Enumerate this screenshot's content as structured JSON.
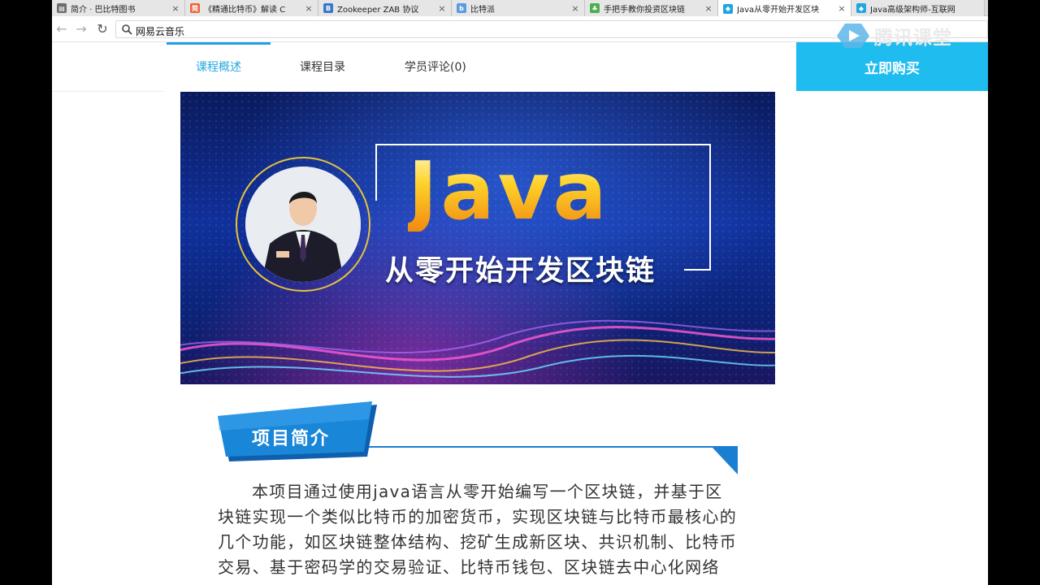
{
  "browser": {
    "tabs": [
      {
        "label": "简介 · 巴比特图书",
        "icon": "book-icon",
        "color": "#5a5a5a"
      },
      {
        "label": "《精通比特币》解读 C",
        "icon": "jian-icon",
        "color": "#e8663d"
      },
      {
        "label": "Zookeeper ZAB 协议",
        "icon": "b-icon",
        "color": "#3a78c9"
      },
      {
        "label": "比特派",
        "icon": "b-icon",
        "color": "#5b9be0"
      },
      {
        "label": "手把手教你投资区块链",
        "icon": "leaf-icon",
        "color": "#4caf50"
      },
      {
        "label": "Java从零开始开发区块",
        "icon": "tencent-icon",
        "color": "#1ea7e0"
      },
      {
        "label": "Java高级架构师-互联网",
        "icon": "tencent-icon",
        "color": "#1ea7e0"
      }
    ],
    "active_tab": 5,
    "close_glyph": "×",
    "back_glyph": "←",
    "forward_glyph": "→",
    "reload_glyph": "↻",
    "address": "网易云音乐"
  },
  "brand": {
    "label": "腾讯课堂"
  },
  "course_nav": {
    "tabs": [
      "课程概述",
      "课程目录",
      "学员评论(0)"
    ],
    "active": 0,
    "buy_label": "立即购买"
  },
  "banner": {
    "title": "Java",
    "subtitle": "从零开始开发区块链"
  },
  "section": {
    "title": "项目简介",
    "body": "本项目通过使用java语言从零开始编写一个区块链，并基于区块链实现一个类似比特币的加密货币，实现区块链与比特币最核心的几个功能，如区块链整体结构、挖矿生成新区块、共识机制、比特币交易、基于密码学的交易验证、比特币钱包、区块链去中心化网络"
  },
  "colors": {
    "accent": "#1fa0e8",
    "buy": "#1fbcf0",
    "section_blue": "#1b7fd1"
  }
}
